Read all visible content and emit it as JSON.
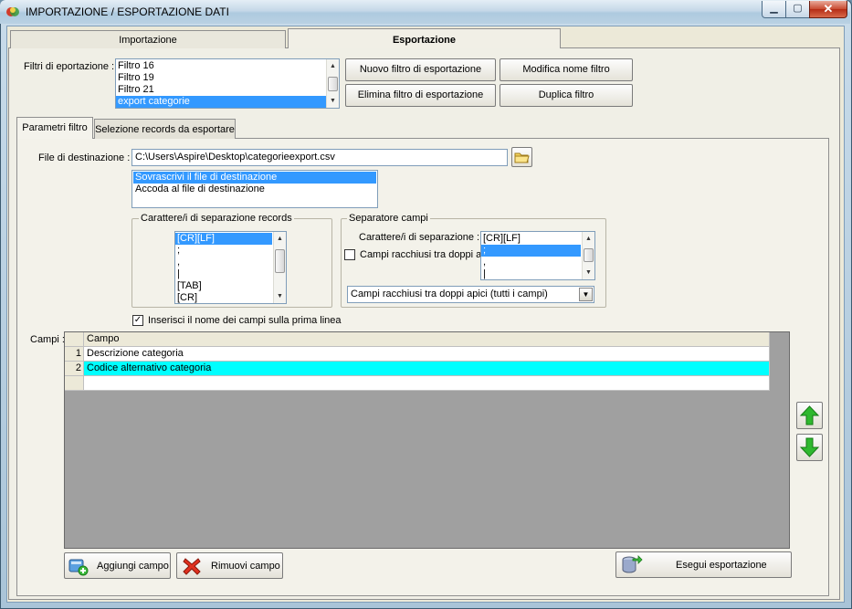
{
  "window": {
    "title": "IMPORTAZIONE / ESPORTAZIONE DATI",
    "min_label": "▁",
    "max_label": "▢",
    "close_label": "✕"
  },
  "tabs": {
    "importazione": "Importazione",
    "esportazione": "Esportazione"
  },
  "filters": {
    "label": "Filtri di eportazione :",
    "items": [
      "Filtro 16",
      "Filtro 19",
      "Filtro 21",
      "export categorie"
    ],
    "selected_index": 3
  },
  "buttons": {
    "new_filter": "Nuovo filtro di esportazione",
    "rename_filter": "Modifica nome filtro",
    "delete_filter": "Elimina filtro di esportazione",
    "duplicate_filter": "Duplica filtro",
    "add_field": "Aggiungi campo",
    "remove_field": "Rimuovi campo",
    "run_export": "Esegui esportazione"
  },
  "inner_tabs": {
    "parametri": "Parametri filtro",
    "selezione": "Selezione records da esportare"
  },
  "destination": {
    "label": "File di destinazione :",
    "value": "C:\\Users\\Aspire\\Desktop\\categorieexport.csv",
    "modes": [
      "Sovrascrivi il file di destinazione",
      "Accoda al file di destinazione"
    ],
    "selected_mode": 0
  },
  "record_separator": {
    "title": "Carattere/i di separazione records",
    "items": [
      "[CR][LF]",
      ";",
      ",",
      "|",
      "[TAB]",
      "[CR]"
    ],
    "selected_index": 0
  },
  "field_separator": {
    "title": "Separatore campi",
    "label": "Carattere/i di separazione :",
    "items": [
      "[CR][LF]",
      ";",
      ",",
      "|"
    ],
    "selected_index": 1,
    "quote_checkbox_label": "Campi racchiusi tra doppi apici",
    "quote_checked": false,
    "quote_mode": "Campi racchiusi tra doppi apici (tutti i campi)"
  },
  "header_option": {
    "label": "Inserisci il nome dei campi sulla prima linea",
    "checked": true
  },
  "fields": {
    "label": "Campi :",
    "column_header": "Campo",
    "rows": [
      {
        "num": "1",
        "name": "Descrizione categoria"
      },
      {
        "num": "2",
        "name": "Codice alternativo categoria"
      }
    ],
    "selected_row": 1
  },
  "colors": {
    "selection": "#3399ff",
    "grid_selection": "#00ffff",
    "arrow_green": "#2fb82f"
  },
  "icons": {
    "folder": "folder-icon",
    "add": "add-field-icon",
    "remove": "remove-field-icon",
    "export": "export-icon",
    "up": "arrow-up-icon",
    "down": "arrow-down-icon"
  }
}
